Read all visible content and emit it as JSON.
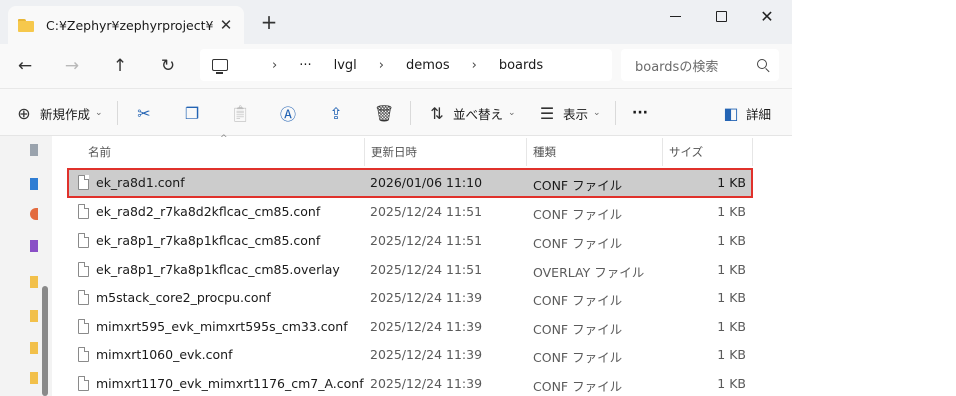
{
  "tab": {
    "title": "C:¥Zephyr¥zephyrproject¥zep",
    "close": "✕",
    "new_tab": "+"
  },
  "window_controls": {
    "close": "✕"
  },
  "nav": {
    "back": "←",
    "forward": "→",
    "up": "↑",
    "refresh": "↻",
    "breadcrumb": [
      "›",
      "···",
      "lvgl",
      "›",
      "demos",
      "›",
      "boards"
    ],
    "search_placeholder": "boardsの検索"
  },
  "commands": {
    "new": "新規作成",
    "sort": "並べ替え",
    "view": "表示",
    "more": "···",
    "details": "詳細"
  },
  "columns": {
    "name": "名前",
    "date": "更新日時",
    "type": "種類",
    "size": "サイズ"
  },
  "files": [
    {
      "name": "ek_ra8d1.conf",
      "date": "2026/01/06 11:10",
      "type": "CONF ファイル",
      "size": "1 KB",
      "selected": true
    },
    {
      "name": "ek_ra8d2_r7ka8d2kflcac_cm85.conf",
      "date": "2025/12/24 11:51",
      "type": "CONF ファイル",
      "size": "1 KB"
    },
    {
      "name": "ek_ra8p1_r7ka8p1kflcac_cm85.conf",
      "date": "2025/12/24 11:51",
      "type": "CONF ファイル",
      "size": "1 KB"
    },
    {
      "name": "ek_ra8p1_r7ka8p1kflcac_cm85.overlay",
      "date": "2025/12/24 11:51",
      "type": "OVERLAY ファイル",
      "size": "1 KB"
    },
    {
      "name": "m5stack_core2_procpu.conf",
      "date": "2025/12/24 11:39",
      "type": "CONF ファイル",
      "size": "1 KB"
    },
    {
      "name": "mimxrt595_evk_mimxrt595s_cm33.conf",
      "date": "2025/12/24 11:39",
      "type": "CONF ファイル",
      "size": "1 KB"
    },
    {
      "name": "mimxrt1060_evk.conf",
      "date": "2025/12/24 11:39",
      "type": "CONF ファイル",
      "size": "1 KB"
    },
    {
      "name": "mimxrt1170_evk_mimxrt1176_cm7_A.conf",
      "date": "2025/12/24 11:39",
      "type": "CONF ファイル",
      "size": "1 KB"
    }
  ],
  "colors": {
    "selection_outline": "#e0312b",
    "selection_fill": "#cccccc",
    "accent": "#2464b4"
  }
}
